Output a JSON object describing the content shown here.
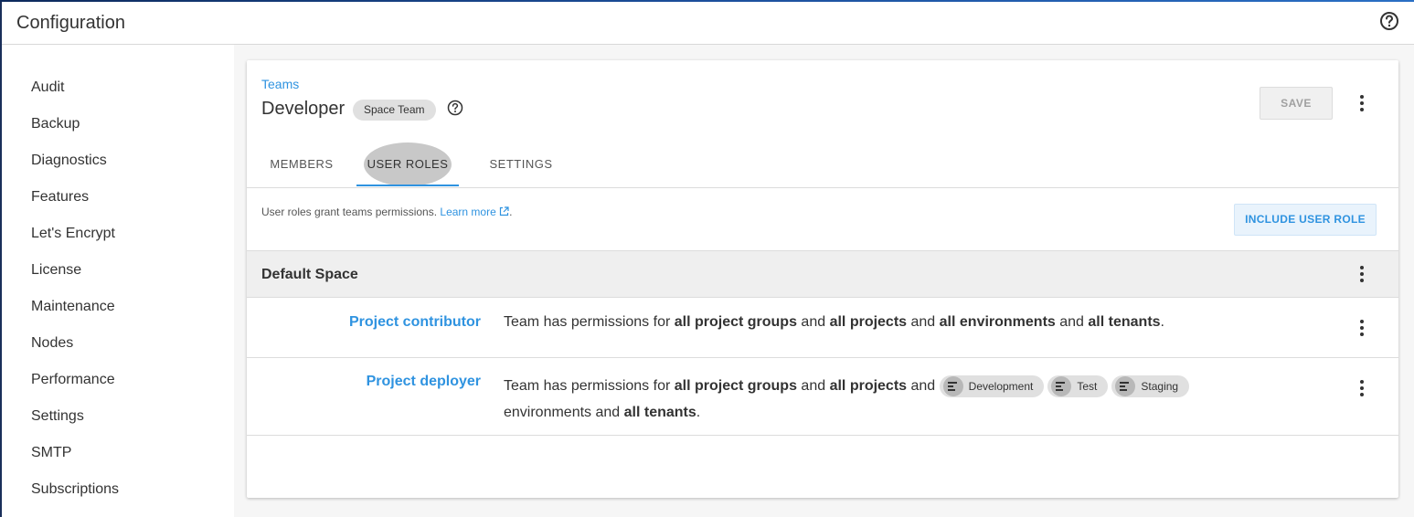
{
  "header": {
    "title": "Configuration"
  },
  "sidebar": {
    "items": [
      {
        "label": "Audit"
      },
      {
        "label": "Backup"
      },
      {
        "label": "Diagnostics"
      },
      {
        "label": "Features"
      },
      {
        "label": "Let's Encrypt"
      },
      {
        "label": "License"
      },
      {
        "label": "Maintenance"
      },
      {
        "label": "Nodes"
      },
      {
        "label": "Performance"
      },
      {
        "label": "Settings"
      },
      {
        "label": "SMTP"
      },
      {
        "label": "Subscriptions"
      }
    ]
  },
  "team": {
    "breadcrumb": "Teams",
    "name": "Developer",
    "badge": "Space Team",
    "save_label": "SAVE"
  },
  "tabs": [
    {
      "label": "MEMBERS"
    },
    {
      "label": "USER ROLES"
    },
    {
      "label": "SETTINGS"
    }
  ],
  "intro": {
    "text": "User roles grant teams permissions. ",
    "link": "Learn more",
    "suffix": "."
  },
  "include_label": "INCLUDE USER ROLE",
  "group": {
    "title": "Default Space"
  },
  "roles": [
    {
      "name": "Project contributor",
      "p1": "Team has permissions for ",
      "b1": "all project groups",
      "p2": " and ",
      "b2": "all projects",
      "p3": " and ",
      "b3": "all environments",
      "p4": " and ",
      "b4": "all tenants",
      "p5": "."
    },
    {
      "name": "Project deployer",
      "p1": "Team has permissions for ",
      "b1": "all project groups",
      "p2": " and ",
      "b2": "all projects",
      "p3": " and ",
      "environments": [
        "Development",
        "Test",
        "Staging"
      ],
      "line2a": "environments and ",
      "line2b": "all tenants",
      "line2c": "."
    }
  ],
  "colors": {
    "accent": "#2f93e0",
    "header_gradient": "#1c4f9c"
  }
}
